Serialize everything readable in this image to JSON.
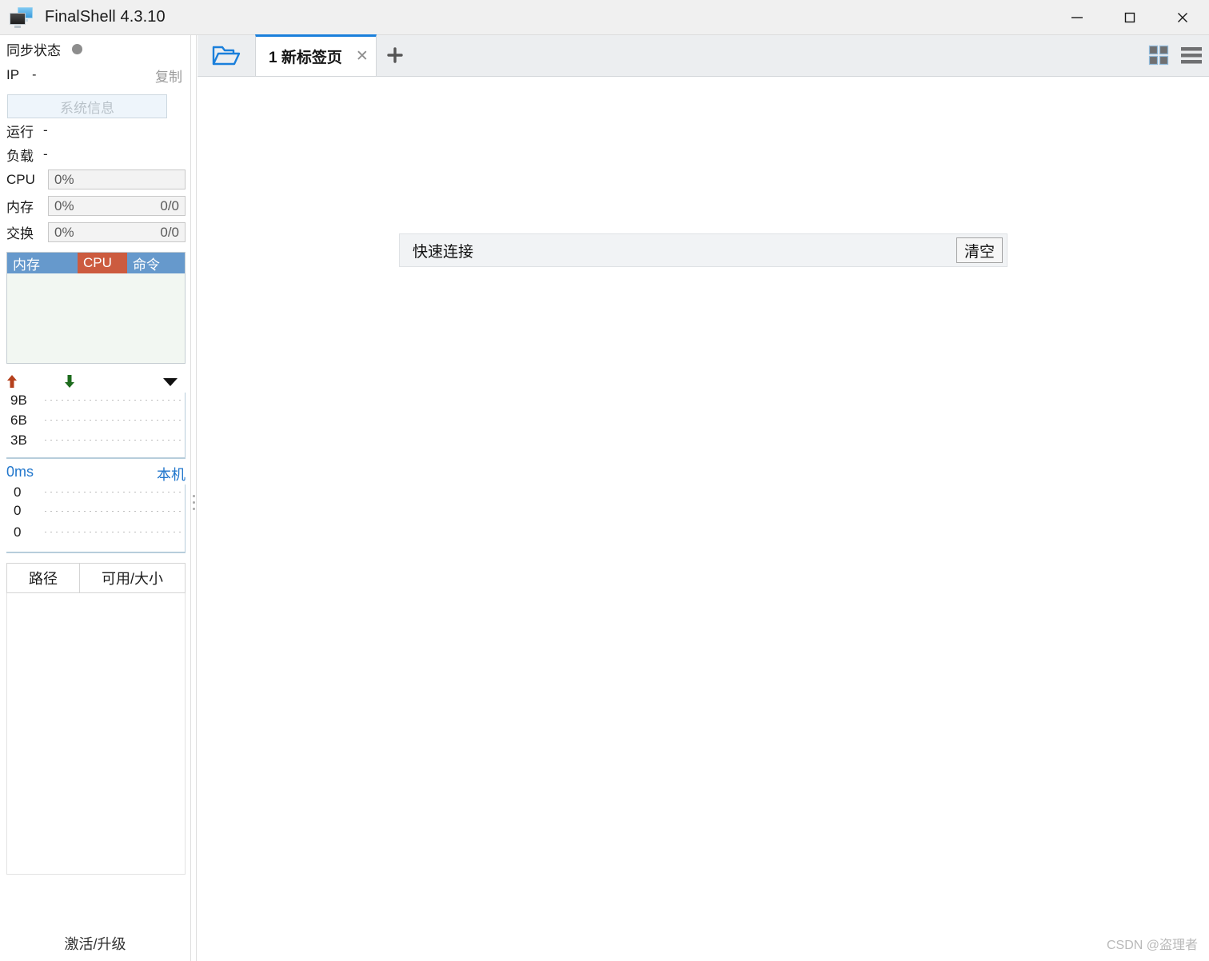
{
  "window": {
    "title": "FinalShell 4.3.10",
    "icon": "app-monitors-icon",
    "minimize_label": "—",
    "maximize_label": "□",
    "close_label": "✕"
  },
  "sidebar": {
    "sync": {
      "label": "同步状态",
      "status_color": "#8d8d8d"
    },
    "ip": {
      "key": "IP",
      "value": "-",
      "copy_label": "复制"
    },
    "system_info_button": "系统信息",
    "stats": [
      {
        "key": "运行",
        "value": "-"
      },
      {
        "key": "负载",
        "value": "-"
      }
    ],
    "meters": [
      {
        "key": "CPU",
        "percent": "0%",
        "detail": ""
      },
      {
        "key": "内存",
        "percent": "0%",
        "detail": "0/0"
      },
      {
        "key": "交换",
        "percent": "0%",
        "detail": "0/0"
      }
    ],
    "process_table": {
      "columns": [
        "内存",
        "CPU",
        "命令"
      ],
      "column_colors": [
        "#6699cc",
        "#cc5b3f",
        "#6699cc"
      ],
      "rows": []
    },
    "network_graph": {
      "upload_icon": "arrow-up-icon",
      "download_icon": "arrow-down-icon",
      "menu_icon": "caret-down-icon",
      "y_labels": [
        "9B",
        "6B",
        "3B"
      ]
    },
    "latency_graph": {
      "latency": "0ms",
      "host": "本机",
      "y_labels": [
        "0",
        "0",
        "0"
      ]
    },
    "disk_table": {
      "columns": [
        "路径",
        "可用/大小"
      ],
      "rows": []
    },
    "activate_label": "激活/升级"
  },
  "main": {
    "tabbar": {
      "folder_icon": "open-folder-icon",
      "tabs": [
        {
          "label": "1 新标签页",
          "close_label": "✕",
          "active": true
        }
      ],
      "new_tab_label": "+",
      "grid_view_icon": "grid-view-icon",
      "list_view_icon": "list-view-icon"
    },
    "quick_connect": {
      "label": "快速连接",
      "clear_button": "清空"
    }
  },
  "watermark": "CSDN @盗理者",
  "colors": {
    "accent_blue": "#1a7fdb",
    "header_blue": "#6699cc",
    "header_orange": "#cc5b3f",
    "link_blue": "#2277cc"
  }
}
